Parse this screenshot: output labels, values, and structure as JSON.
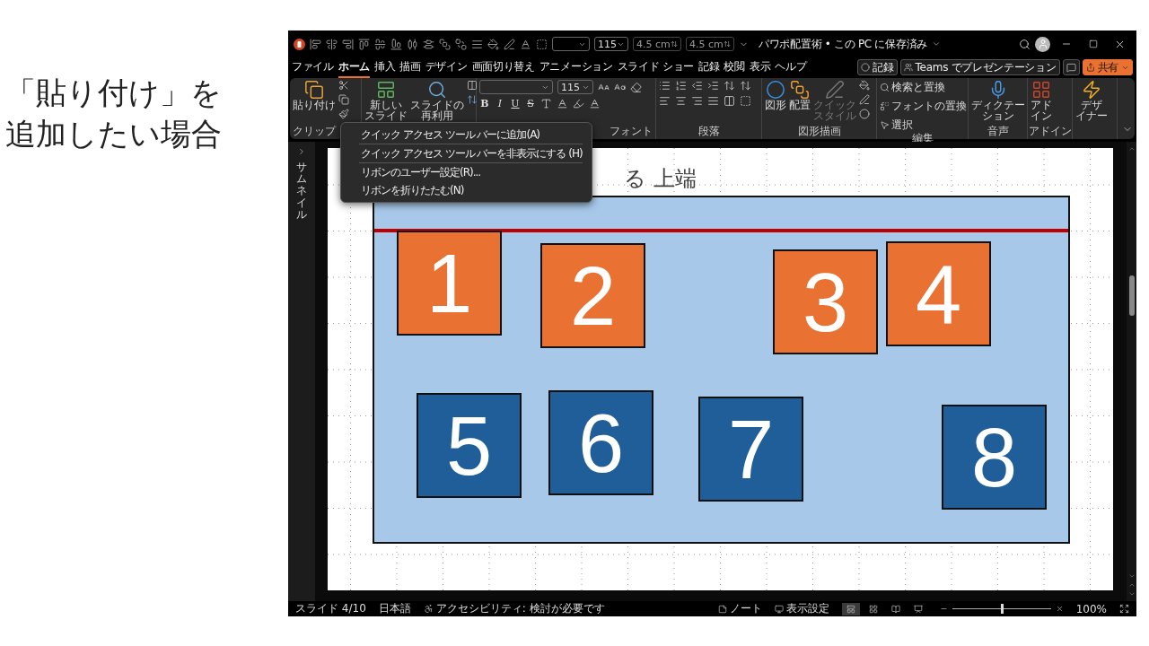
{
  "caption": [
    "「貼り付け」を",
    "追加したい場合"
  ],
  "window": {
    "title": "パワポ配置術 • この PC に保存済み",
    "quick_fields": [
      {
        "disabled": false
      },
      {
        "value": "115",
        "disabled": false
      },
      {
        "value": "4.5 cm",
        "disabled": true
      },
      {
        "value": "4.5 cm",
        "disabled": true
      }
    ]
  },
  "menu_tabs": [
    {
      "label": "ファイル",
      "selected": false
    },
    {
      "label": "ホーム",
      "selected": true
    },
    {
      "label": "挿入",
      "selected": false
    },
    {
      "label": "描画",
      "selected": false
    },
    {
      "label": "デザイン",
      "selected": false
    },
    {
      "label": "画面切り替え",
      "selected": false
    },
    {
      "label": "アニメーション",
      "selected": false
    },
    {
      "label": "スライド ショー",
      "selected": false
    },
    {
      "label": "記録",
      "selected": false
    },
    {
      "label": "校閲",
      "selected": false
    },
    {
      "label": "表示",
      "selected": false
    },
    {
      "label": "ヘルプ",
      "selected": false
    }
  ],
  "header_buttons": [
    {
      "kind": "record",
      "label": "記録"
    },
    {
      "kind": "teams",
      "label": "Teams でプレゼンテーション"
    },
    {
      "kind": "comment"
    },
    {
      "kind": "share",
      "label": "共有"
    }
  ],
  "ribbon": [
    {
      "kind": "clipboard",
      "label": "クリップ",
      "buttons": [
        {
          "lines": [
            "貼り付け"
          ]
        }
      ]
    },
    {
      "kind": "slides",
      "buttons": [
        {
          "lines": [
            "新しい",
            "スライド"
          ]
        },
        {
          "lines": [
            "スライドの",
            "再利用"
          ]
        }
      ]
    },
    {
      "kind": "font",
      "label": "フォント",
      "font_size": "115",
      "letters": [
        "B",
        "I",
        "U",
        "S"
      ]
    },
    {
      "kind": "paragraph",
      "label": "段落"
    },
    {
      "kind": "drawing",
      "label": "図形描画",
      "buttons": [
        {
          "lines": [
            "図形"
          ],
          "disabled": false
        },
        {
          "lines": [
            "配置"
          ],
          "disabled": false
        },
        {
          "lines": [
            "クイック",
            "スタイル"
          ],
          "disabled": true
        }
      ]
    },
    {
      "kind": "editing",
      "label": "編集",
      "buttons": [
        {
          "label": "検索と置換"
        },
        {
          "label": "フォントの置換"
        },
        {
          "label": "選択"
        }
      ]
    },
    {
      "kind": "voice",
      "label": "音声",
      "buttons": [
        {
          "lines": [
            "ディクテー",
            "ション"
          ]
        }
      ]
    },
    {
      "kind": "addin",
      "label": "アドイン",
      "buttons": [
        {
          "lines": [
            "アド",
            "イン"
          ]
        }
      ]
    },
    {
      "kind": "designer",
      "buttons": [
        {
          "lines": [
            "デザ",
            "イナー"
          ]
        }
      ]
    }
  ],
  "context_menu": [
    {
      "label": "クイック アクセス ツール バーに追加(A)",
      "divider_after": true
    },
    {
      "label": "クイック アクセス ツール バーを非表示にする (H)",
      "divider_after": true
    },
    {
      "label": "リボンのユーザー設定(R)...",
      "divider_after": false
    },
    {
      "label": "リボンを折りたたむ(N)",
      "divider_after": false
    }
  ],
  "thumbnail_pane": {
    "label": "サムネイル"
  },
  "slide": {
    "title": "る 上端",
    "shapes": [
      {
        "label": "1",
        "color": "#e97132"
      },
      {
        "label": "2",
        "color": "#e97132"
      },
      {
        "label": "3",
        "color": "#e97132"
      },
      {
        "label": "4",
        "color": "#e97132"
      },
      {
        "label": "5",
        "color": "#1f5e99"
      },
      {
        "label": "6",
        "color": "#1f5e99"
      },
      {
        "label": "7",
        "color": "#1f5e99"
      },
      {
        "label": "8",
        "color": "#1f5e99"
      }
    ]
  },
  "status_bar": {
    "slide": "スライド 4/10",
    "language": "日本語",
    "accessibility": "アクセシビリティ: 検討が必要です",
    "notes": "ノート",
    "display": "表示設定",
    "views": [
      {
        "selected": true
      },
      {
        "selected": false
      },
      {
        "selected": false
      },
      {
        "selected": false
      }
    ],
    "zoom": {
      "level": 0.5,
      "reading": "100%"
    }
  }
}
